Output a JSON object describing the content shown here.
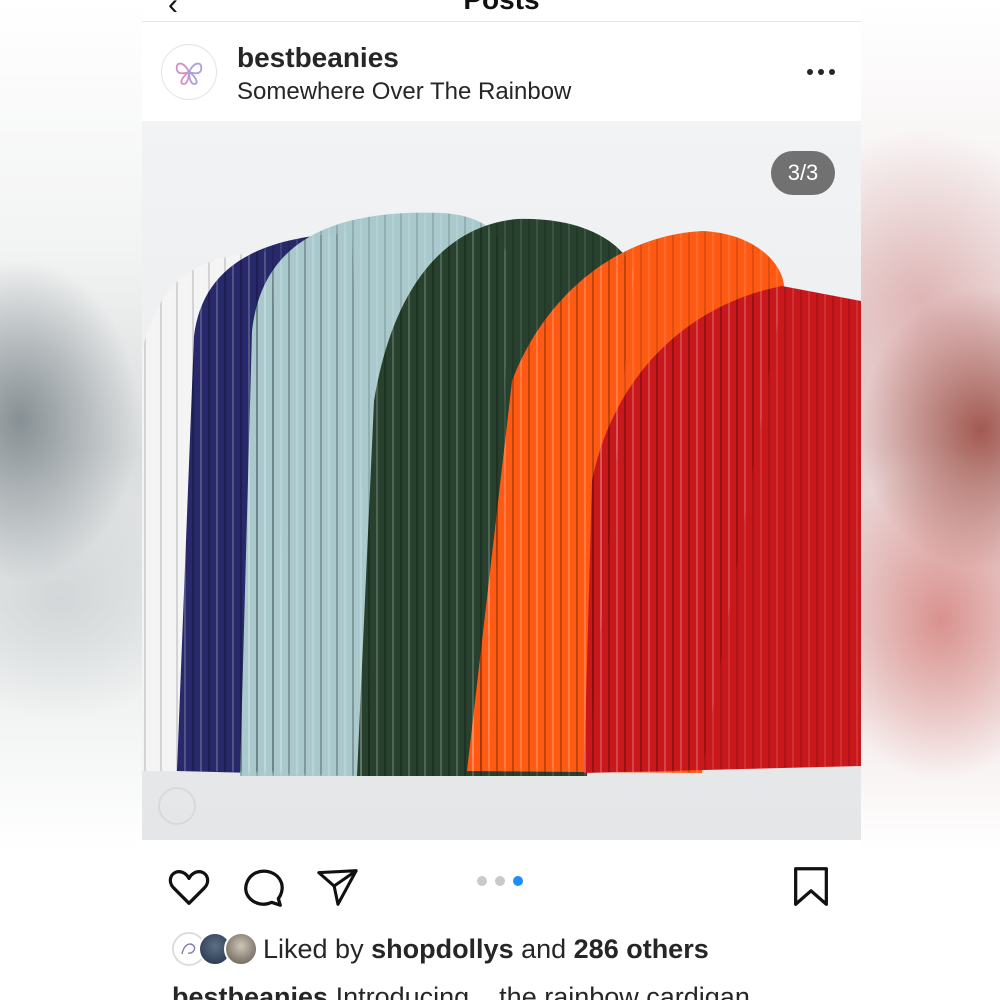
{
  "header": {
    "title": "Posts"
  },
  "post": {
    "username": "bestbeanies",
    "location": "Somewhere Over The Rainbow",
    "image_counter": "3/3",
    "carousel": {
      "total": 3,
      "active": 3
    },
    "beanie_colors": [
      "#f4f4f4",
      "#27296a",
      "#a9c9cc",
      "#27412e",
      "#ff5a14",
      "#c8181c"
    ],
    "icons": {
      "like": "heart-icon",
      "comment": "comment-icon",
      "share": "send-icon",
      "save": "bookmark-icon",
      "more": "more-icon"
    },
    "likes": {
      "prefix": "Liked by ",
      "user": "shopdollys",
      "middle": " and ",
      "count": "286 others"
    },
    "caption": {
      "username": "bestbeanies",
      "text": " Introducing... the rainbow cardigan"
    },
    "colors": {
      "text": "#262626",
      "accent_dot": "#1c8ef9"
    }
  }
}
